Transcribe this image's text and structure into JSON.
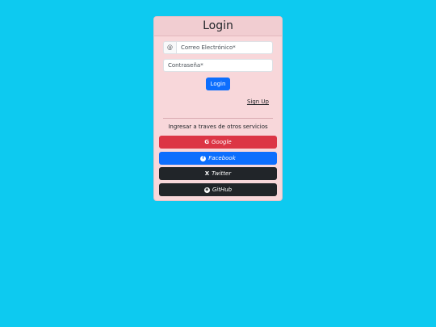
{
  "card": {
    "title": "Login"
  },
  "form": {
    "email_prefix": "@",
    "email_placeholder": "Correo Electrónico*",
    "password_placeholder": "Contraseña*",
    "login_label": "Login",
    "signup_label": "Sign Up"
  },
  "social": {
    "heading": "Ingresar a traves de otros servicios",
    "buttons": [
      {
        "label": "Google",
        "icon": "G"
      },
      {
        "label": "Facebook",
        "icon": "f"
      },
      {
        "label": "Twitter",
        "icon": "X"
      },
      {
        "label": "GitHub",
        "icon": "◉"
      }
    ]
  },
  "colors": {
    "page_background": "#0dcaf0",
    "card_background": "#f8d7da",
    "primary": "#0d6efd",
    "danger": "#dc3545",
    "dark": "#212529"
  }
}
